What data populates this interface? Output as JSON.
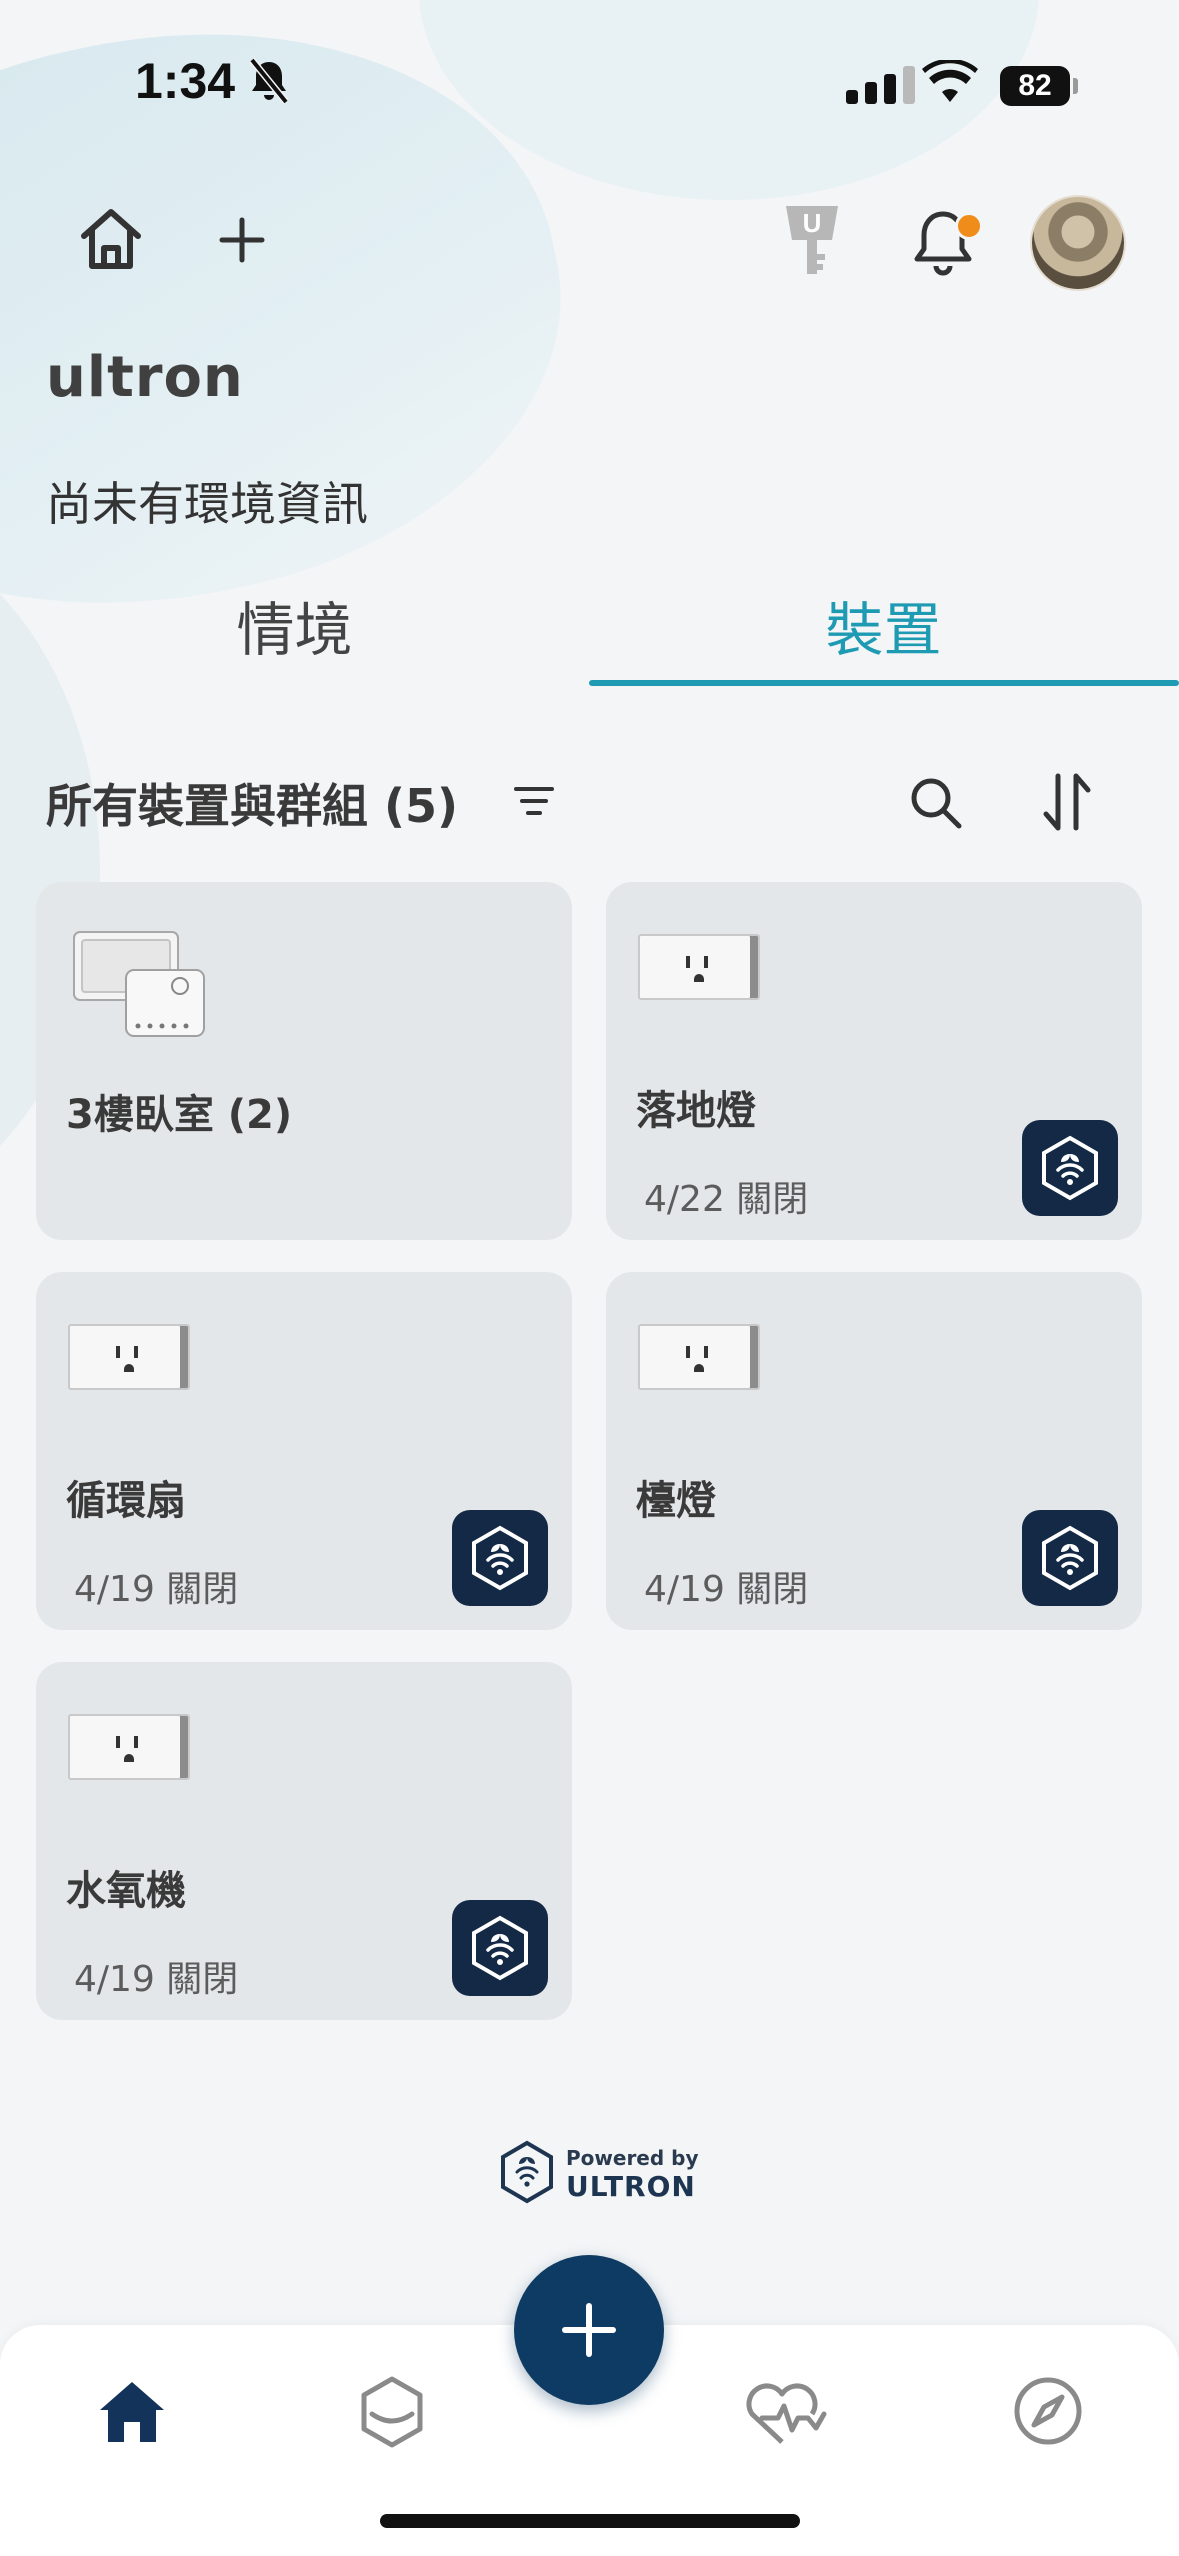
{
  "status_bar": {
    "time": "1:34",
    "battery": "82"
  },
  "header": {
    "home_name": "ultron",
    "environment_info": "尚未有環境資訊"
  },
  "tabs": [
    {
      "label": "情境",
      "active": false
    },
    {
      "label": "裝置",
      "active": true
    }
  ],
  "devices_section": {
    "title": "所有裝置與群組 (5)"
  },
  "devices": [
    {
      "name": "3樓臥室 (2)",
      "status": ""
    },
    {
      "name": "落地燈",
      "status": "4/22 關閉"
    },
    {
      "name": "循環扇",
      "status": "4/19 關閉"
    },
    {
      "name": "檯燈",
      "status": "4/19 關閉"
    },
    {
      "name": "水氧機",
      "status": "4/19 關閉"
    }
  ],
  "footer": {
    "powered_by": "Powered by",
    "brand": "ULTRON"
  },
  "colors": {
    "accent": "#1e9ab3",
    "navy": "#132945",
    "fab": "#0e3b63",
    "notification": "#f08c1a"
  },
  "icons": {
    "topbar": [
      "home-icon",
      "plus-icon",
      "key-badge-icon",
      "bell-icon",
      "avatar"
    ],
    "bottom_nav": [
      "home-icon",
      "hexagon-icon",
      "heart-pulse-icon",
      "compass-icon"
    ]
  }
}
